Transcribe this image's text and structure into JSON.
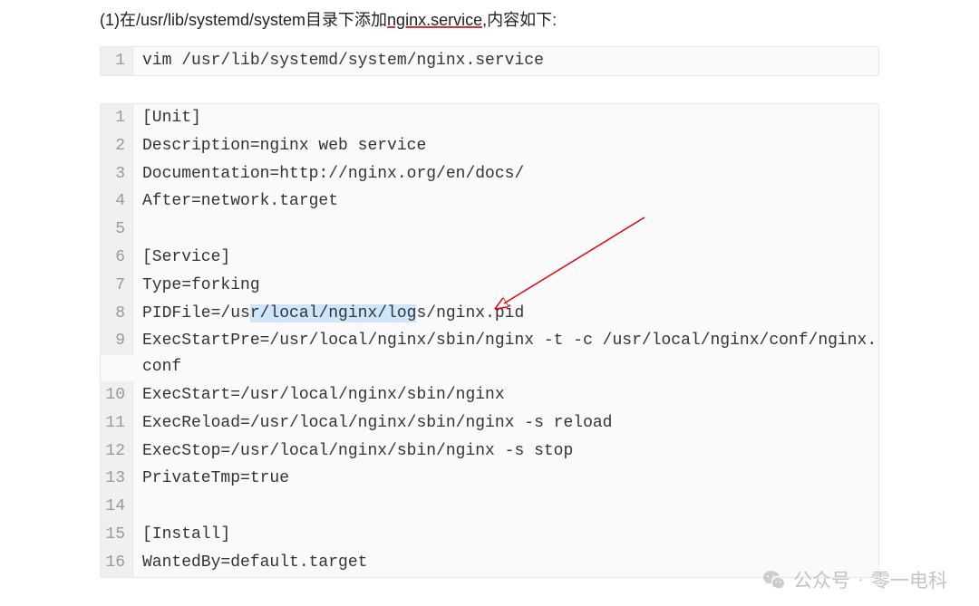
{
  "instruction": {
    "prefix": "(1)在/usr/lib/systemd/system目录下添加",
    "underlined": "nginx.service",
    "suffix": ",内容如下:"
  },
  "command_block": {
    "lines": [
      {
        "num": "1",
        "text": "vim /usr/lib/systemd/system/nginx.service"
      }
    ]
  },
  "service_block": {
    "lines": [
      {
        "num": "1",
        "text": "[Unit]"
      },
      {
        "num": "2",
        "text": "Description=nginx web service"
      },
      {
        "num": "3",
        "text": "Documentation=http://nginx.org/en/docs/"
      },
      {
        "num": "4",
        "text": "After=network.target"
      },
      {
        "num": "5",
        "text": ""
      },
      {
        "num": "6",
        "text": "[Service]"
      },
      {
        "num": "7",
        "text": "Type=forking"
      },
      {
        "num": "8",
        "pre": "PIDFile=/us",
        "highlight": "r/local/nginx/log",
        "post": "s/nginx.pid"
      },
      {
        "num": "9",
        "text": "ExecStartPre=/usr/local/nginx/sbin/nginx -t -c /usr/local/nginx/conf/nginx.conf"
      },
      {
        "num": "10",
        "text": "ExecStart=/usr/local/nginx/sbin/nginx"
      },
      {
        "num": "11",
        "text": "ExecReload=/usr/local/nginx/sbin/nginx -s reload"
      },
      {
        "num": "12",
        "text": "ExecStop=/usr/local/nginx/sbin/nginx -s stop"
      },
      {
        "num": "13",
        "text": "PrivateTmp=true"
      },
      {
        "num": "14",
        "text": ""
      },
      {
        "num": "15",
        "text": "[Install]"
      },
      {
        "num": "16",
        "text": "WantedBy=default.target"
      }
    ]
  },
  "watermark": {
    "label": "公众号",
    "sep": "·",
    "name": "零一电科"
  }
}
